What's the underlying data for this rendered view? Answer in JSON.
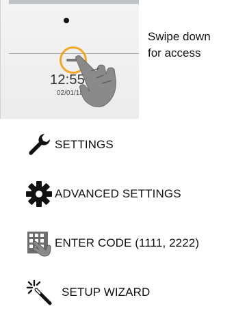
{
  "device": {
    "clock_time": "12:55 PM",
    "clock_date": "02/01/18"
  },
  "hint": {
    "line1": "Swipe down",
    "line2": "for access"
  },
  "menu": [
    {
      "label": "SETTINGS",
      "icon": "wrench-icon"
    },
    {
      "label": "ADVANCED SETTINGS",
      "icon": "gear-icon"
    },
    {
      "label": "ENTER CODE (1111, 2222)",
      "icon": "keypad-hand-icon"
    },
    {
      "label": "SETUP WIZARD",
      "icon": "magic-wand-icon"
    }
  ],
  "colors": {
    "accent": "#f5a623",
    "icon": "#111111"
  }
}
